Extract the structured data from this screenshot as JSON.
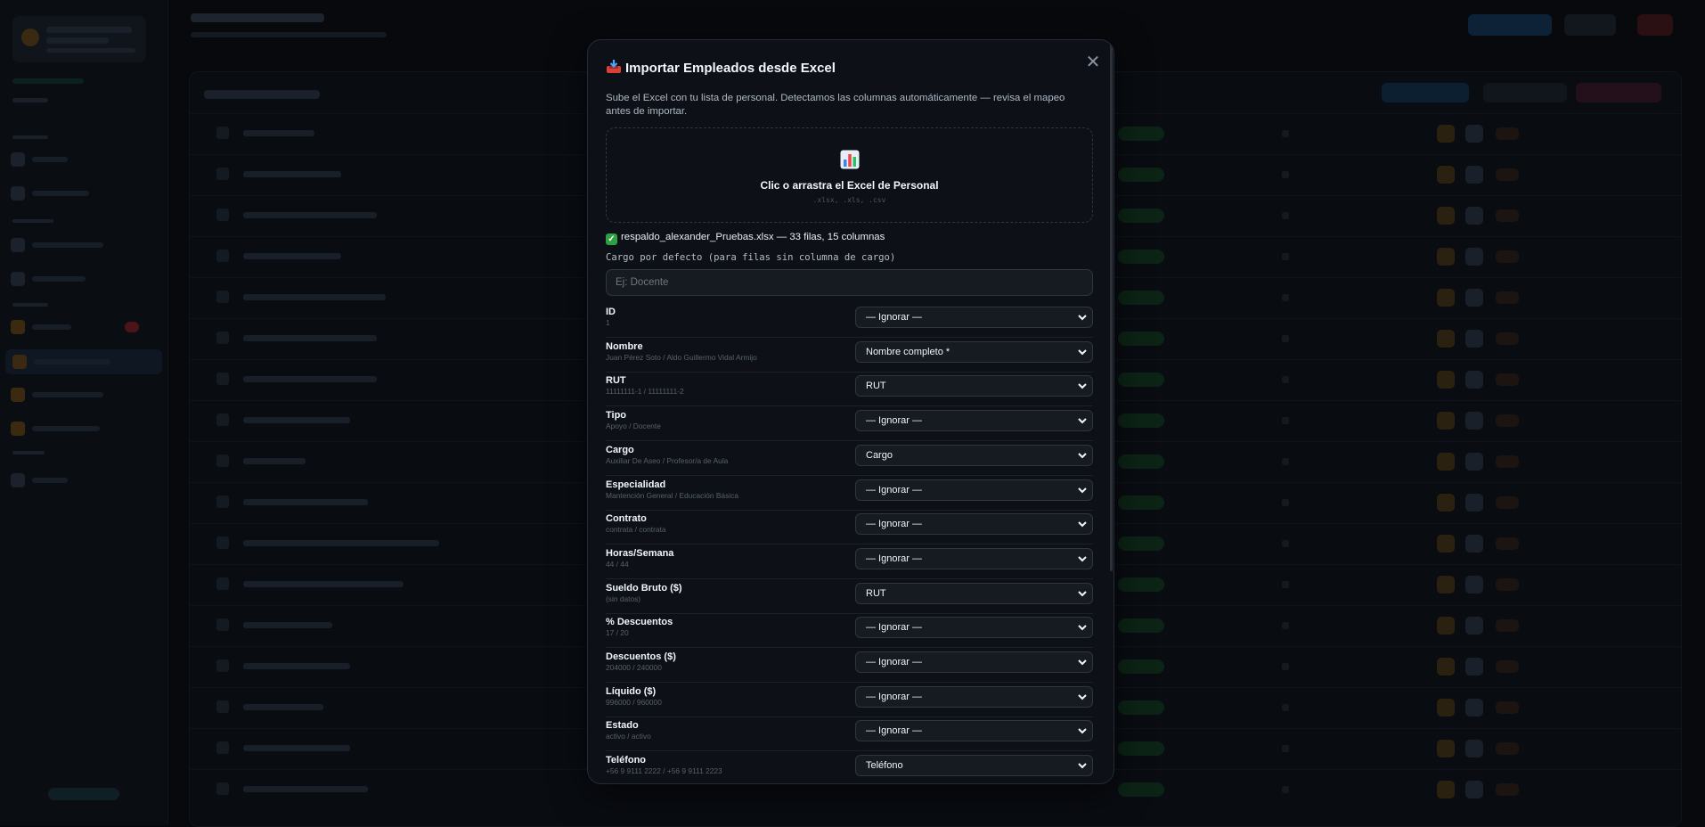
{
  "modal": {
    "title": "Importar Empleados desde Excel",
    "description": "Sube el Excel con tu lista de personal. Detectamos las columnas automáticamente — revisa el mapeo antes de importar.",
    "dropzone": {
      "title": "Clic o arrastra el Excel de Personal",
      "formats": ".xlsx, .xls, .csv"
    },
    "file_status": "respaldo_alexander_Pruebas.xlsx — 33 filas, 15 columnas",
    "default_cargo": {
      "label": "Cargo por defecto (para filas sin columna de cargo)",
      "placeholder": "Ej: Docente",
      "value": ""
    },
    "mappings": [
      {
        "column": "ID",
        "sample": "1",
        "selected": "— Ignorar —"
      },
      {
        "column": "Nombre",
        "sample": "Juan Pérez Soto / Aldo Guillermo Vidal Armijo",
        "selected": "Nombre completo *"
      },
      {
        "column": "RUT",
        "sample": "11111111-1 / 11111111-2",
        "selected": "RUT"
      },
      {
        "column": "Tipo",
        "sample": "Apoyo / Docente",
        "selected": "— Ignorar —"
      },
      {
        "column": "Cargo",
        "sample": "Auxiliar De Aseo / Profesor/a de Aula",
        "selected": "Cargo"
      },
      {
        "column": "Especialidad",
        "sample": "Mantención General / Educación Básica",
        "selected": "— Ignorar —"
      },
      {
        "column": "Contrato",
        "sample": "contrata / contrata",
        "selected": "— Ignorar —"
      },
      {
        "column": "Horas/Semana",
        "sample": "44 / 44",
        "selected": "— Ignorar —"
      },
      {
        "column": "Sueldo Bruto ($)",
        "sample": "(sin datos)",
        "selected": "RUT"
      },
      {
        "column": "% Descuentos",
        "sample": "17 / 20",
        "selected": "— Ignorar —"
      },
      {
        "column": "Descuentos ($)",
        "sample": "204000 / 240000",
        "selected": "— Ignorar —"
      },
      {
        "column": "Líquido ($)",
        "sample": "996000 / 960000",
        "selected": "— Ignorar —"
      },
      {
        "column": "Estado",
        "sample": "activo / activo",
        "selected": "— Ignorar —"
      },
      {
        "column": "Teléfono",
        "sample": "+56 9 9111 2222 / +56 9 9111 2223",
        "selected": "Teléfono"
      }
    ]
  },
  "icons": {
    "title": "inbox-tray-icon",
    "dropzone": "bar-chart-icon",
    "file_status": "check-mark-icon",
    "close": "close-icon",
    "select": "chevron-down-icon"
  },
  "colors": {
    "overlay_background": "#07090d",
    "modal_background": "#0d1117",
    "success": "#2ea043"
  }
}
